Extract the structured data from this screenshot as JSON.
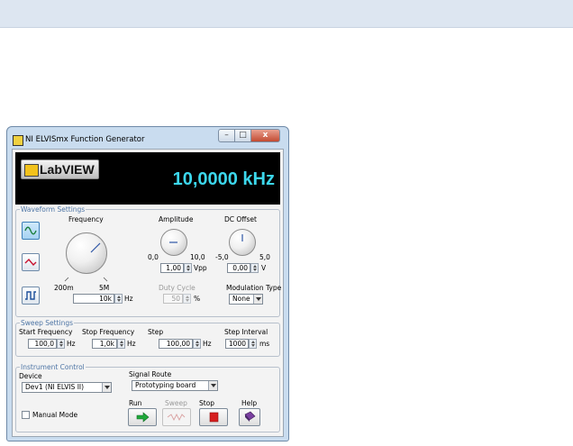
{
  "window": {
    "title": "NI ELVISmx Function Generator",
    "close_glyph": "x"
  },
  "header": {
    "logo_text": "LabVIEW",
    "frequency_display": "10,0000 kHz"
  },
  "waveform": {
    "group_title": "Waveform Settings",
    "frequency_label": "Frequency",
    "frequency_min": "200m",
    "frequency_max": "5M",
    "frequency_value": "10k",
    "frequency_unit": "Hz",
    "amplitude_label": "Amplitude",
    "amplitude_min": "0,0",
    "amplitude_max": "10,0",
    "amplitude_value": "1,00",
    "amplitude_unit": "Vpp",
    "dc_offset_label": "DC Offset",
    "dc_offset_min": "-5,0",
    "dc_offset_max": "5,0",
    "dc_offset_value": "0,00",
    "dc_offset_unit": "V",
    "duty_cycle_label": "Duty Cycle",
    "duty_cycle_value": "50",
    "duty_cycle_unit": "%",
    "modulation_label": "Modulation Type",
    "modulation_value": "None",
    "waveforms": [
      "sine",
      "triangle",
      "square"
    ],
    "selected_waveform": "sine",
    "colors": {
      "sine": "#1a7f3c",
      "triangle": "#c8102e",
      "square": "#1d4f9a"
    }
  },
  "sweep": {
    "group_title": "Sweep Settings",
    "start_label": "Start Frequency",
    "start_value": "100,0",
    "start_unit": "Hz",
    "stop_label": "Stop Frequency",
    "stop_value": "1,0k",
    "stop_unit": "Hz",
    "step_label": "Step",
    "step_value": "100,00",
    "step_unit": "Hz",
    "interval_label": "Step Interval",
    "interval_value": "1000",
    "interval_unit": "ms"
  },
  "instrument": {
    "group_title": "Instrument Control",
    "device_label": "Device",
    "device_value": "Dev1 (NI ELVIS II)",
    "route_label": "Signal Route",
    "route_value": "Prototyping board",
    "manual_mode_label": "Manual Mode",
    "run_label": "Run",
    "sweep_label": "Sweep",
    "stop_label": "Stop",
    "help_label": "Help"
  },
  "colors": {
    "display_text": "#3cd7ec",
    "group_title": "#4f76a6",
    "run_arrow": "#1fa83a",
    "stop_square": "#d61f1f"
  }
}
